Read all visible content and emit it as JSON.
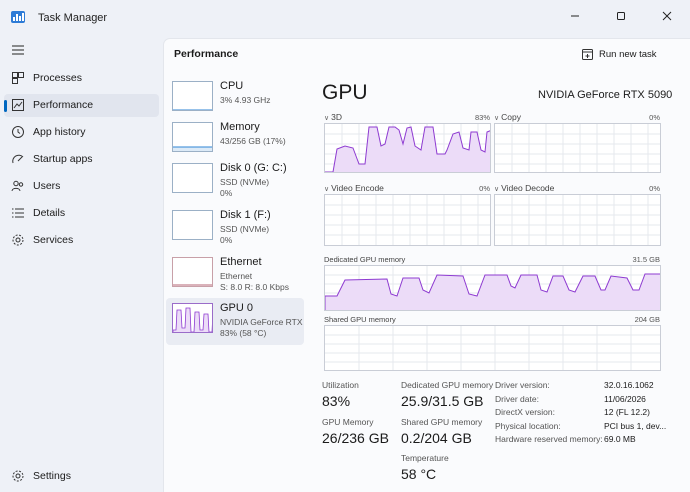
{
  "window": {
    "title": "Task Manager",
    "controls": [
      "minimize",
      "maximize",
      "close"
    ]
  },
  "nav": {
    "items": [
      {
        "id": "processes",
        "label": "Processes",
        "icon": "processes-icon"
      },
      {
        "id": "performance",
        "label": "Performance",
        "icon": "performance-icon",
        "active": true
      },
      {
        "id": "app-history",
        "label": "App history",
        "icon": "app-history-icon"
      },
      {
        "id": "startup-apps",
        "label": "Startup apps",
        "icon": "startup-apps-icon"
      },
      {
        "id": "users",
        "label": "Users",
        "icon": "users-icon"
      },
      {
        "id": "details",
        "label": "Details",
        "icon": "details-icon"
      },
      {
        "id": "services",
        "label": "Services",
        "icon": "services-icon"
      }
    ],
    "settings_label": "Settings"
  },
  "page": {
    "title": "Performance",
    "run_new_task_label": "Run new task"
  },
  "resources": [
    {
      "name": "CPU",
      "sub": [
        "3%  4.93 GHz"
      ]
    },
    {
      "name": "Memory",
      "sub": [
        "43/256 GB (17%)"
      ]
    },
    {
      "name": "Disk 0 (G: C:)",
      "sub": [
        "SSD (NVMe)",
        "0%"
      ]
    },
    {
      "name": "Disk 1 (F:)",
      "sub": [
        "SSD (NVMe)",
        "0%"
      ]
    },
    {
      "name": "Ethernet",
      "sub": [
        "Ethernet",
        "S: 8.0  R: 8.0 Kbps"
      ]
    },
    {
      "name": "GPU 0",
      "sub": [
        "NVIDIA GeForce RTX ...",
        "83%  (58 °C)"
      ],
      "active": true
    }
  ],
  "gpu": {
    "heading": "GPU",
    "model": "NVIDIA GeForce RTX 5090",
    "engines": [
      {
        "label": "3D",
        "percent": "83%"
      },
      {
        "label": "Copy",
        "percent": "0%"
      },
      {
        "label": "Video Encode",
        "percent": "0%"
      },
      {
        "label": "Video Decode",
        "percent": "0%"
      }
    ],
    "dedicated_memory": {
      "label": "Dedicated GPU memory",
      "max": "31.5 GB"
    },
    "shared_memory": {
      "label": "Shared GPU memory",
      "max": "204 GB"
    },
    "stats": {
      "utilization": {
        "label": "Utilization",
        "value": "83%"
      },
      "dedicated": {
        "label": "Dedicated GPU memory",
        "value": "25.9/31.5 GB"
      },
      "gpu_memory": {
        "label": "GPU Memory",
        "value": "26/236 GB"
      },
      "shared": {
        "label": "Shared GPU memory",
        "value": "0.2/204 GB"
      },
      "temperature": {
        "label": "Temperature",
        "value": "58 °C"
      }
    },
    "info": [
      {
        "label": "Driver version:",
        "value": "32.0.16.1062"
      },
      {
        "label": "Driver date:",
        "value": "11/06/2026"
      },
      {
        "label": "DirectX version:",
        "value": "12 (FL 12.2)"
      },
      {
        "label": "Physical location:",
        "value": "PCI bus 1, dev..."
      },
      {
        "label": "Hardware reserved memory:",
        "value": "69.0 MB"
      }
    ]
  },
  "colors": {
    "accent": "#0067c0",
    "gpu_line": "#8e3bd1",
    "gpu_fill": "#ecdcf8",
    "grid": "#e6e8ee"
  }
}
